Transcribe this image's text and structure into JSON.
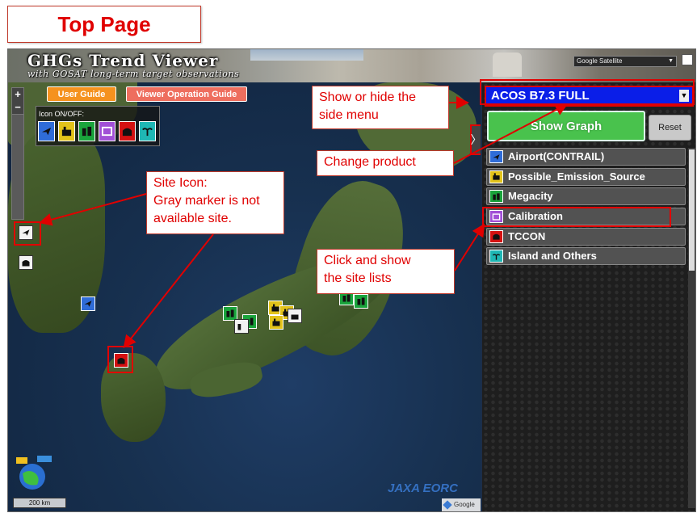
{
  "page_tag": "Top Page",
  "app": {
    "title": "GHGs Trend Viewer",
    "subtitle": "with GOSAT long-term target observations",
    "basemap_selected": "Google Satellite",
    "user_guide": "User Guide",
    "operation_guide": "Viewer Operation Guide",
    "icon_toggle_label": "Icon ON/OFF:",
    "zoom_in": "+",
    "zoom_out": "−",
    "scale": "200 km",
    "google_attr": "Google",
    "jaxa_logo": "JAXA EORC",
    "side_toggle_glyph": "〉"
  },
  "side_panel": {
    "product": "ACOS B7.3 FULL",
    "show_graph": "Show Graph",
    "reset": "Reset",
    "site_categories": [
      {
        "label": "Airport(CONTRAIL)",
        "color": "#2f6cd8",
        "icon": "airplane-icon"
      },
      {
        "label": "Possible_Emission_Source",
        "color": "#e3c31a",
        "icon": "factory-icon"
      },
      {
        "label": "Megacity",
        "color": "#1aa43c",
        "icon": "building-icon"
      },
      {
        "label": "Calibration",
        "color": "#a14fd6",
        "icon": "calibration-icon"
      },
      {
        "label": "TCCON",
        "color": "#d41111",
        "icon": "tccon-icon"
      },
      {
        "label": "Island and Others",
        "color": "#1fb7b4",
        "icon": "island-icon"
      }
    ]
  },
  "annotations": {
    "show_hide": [
      "Show or hide the",
      "side menu"
    ],
    "change_product": "Change product",
    "site_icon": [
      "Site Icon:",
      "Gray marker  is not",
      "available site."
    ],
    "click_show": [
      "Click and show",
      "the site lists"
    ]
  }
}
